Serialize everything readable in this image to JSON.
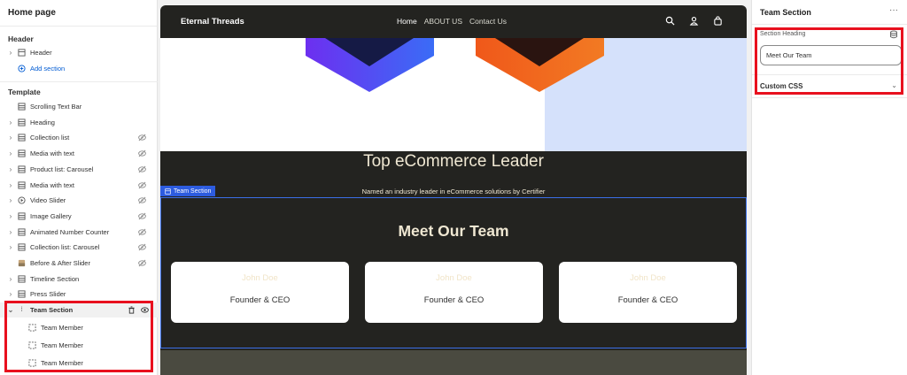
{
  "sidebar": {
    "title": "Home page",
    "header_group": "Header",
    "header_item": "Header",
    "add_section": "Add section",
    "template_group": "Template",
    "items": [
      {
        "label": "Scrolling Text Bar",
        "icon": "section-icon",
        "chevron": false,
        "hide": false
      },
      {
        "label": "Heading",
        "icon": "section-icon",
        "chevron": true,
        "hide": false
      },
      {
        "label": "Collection list",
        "icon": "section-icon",
        "chevron": true,
        "hide": true
      },
      {
        "label": "Media with text",
        "icon": "section-icon",
        "chevron": true,
        "hide": true
      },
      {
        "label": "Product list: Carousel",
        "icon": "section-icon",
        "chevron": true,
        "hide": true
      },
      {
        "label": "Media with text",
        "icon": "section-icon",
        "chevron": true,
        "hide": true
      },
      {
        "label": "Video Slider",
        "icon": "play-icon",
        "chevron": true,
        "hide": true
      },
      {
        "label": "Image Gallery",
        "icon": "section-icon",
        "chevron": true,
        "hide": true
      },
      {
        "label": "Animated Number Counter",
        "icon": "section-icon",
        "chevron": true,
        "hide": true
      },
      {
        "label": "Collection list: Carousel",
        "icon": "section-icon",
        "chevron": true,
        "hide": true
      },
      {
        "label": "Before & After Slider",
        "icon": "image-icon",
        "chevron": false,
        "hide": true
      },
      {
        "label": "Timeline Section",
        "icon": "section-icon",
        "chevron": true,
        "hide": false
      },
      {
        "label": "Press Slider",
        "icon": "section-icon",
        "chevron": true,
        "hide": false
      }
    ],
    "selected": {
      "label": "Team Section"
    },
    "children": [
      {
        "label": "Team Member"
      },
      {
        "label": "Team Member"
      },
      {
        "label": "Team Member"
      }
    ]
  },
  "preview": {
    "brand": "Eternal Threads",
    "nav_links": [
      "Home",
      "ABOUT US",
      "Contact Us"
    ],
    "section_heading": "Top eCommerce Leader",
    "section_sub": "Named an industry leader in eCommerce solutions by Certifier",
    "team_tag": "Team Section",
    "team_title": "Meet Our Team",
    "cards": [
      {
        "name": "John Doe",
        "role": "Founder & CEO"
      },
      {
        "name": "John Doe",
        "role": "Founder & CEO"
      },
      {
        "name": "John Doe",
        "role": "Founder & CEO"
      }
    ]
  },
  "panel": {
    "title": "Team Section",
    "more": "···",
    "heading_label": "Section Heading",
    "heading_value": "Meet Our Team",
    "custom_css": "Custom CSS"
  },
  "colors": {
    "highlight": "#e8101e",
    "accent": "#2d5ce0",
    "dark": "#232320",
    "link": "#005bd3"
  }
}
